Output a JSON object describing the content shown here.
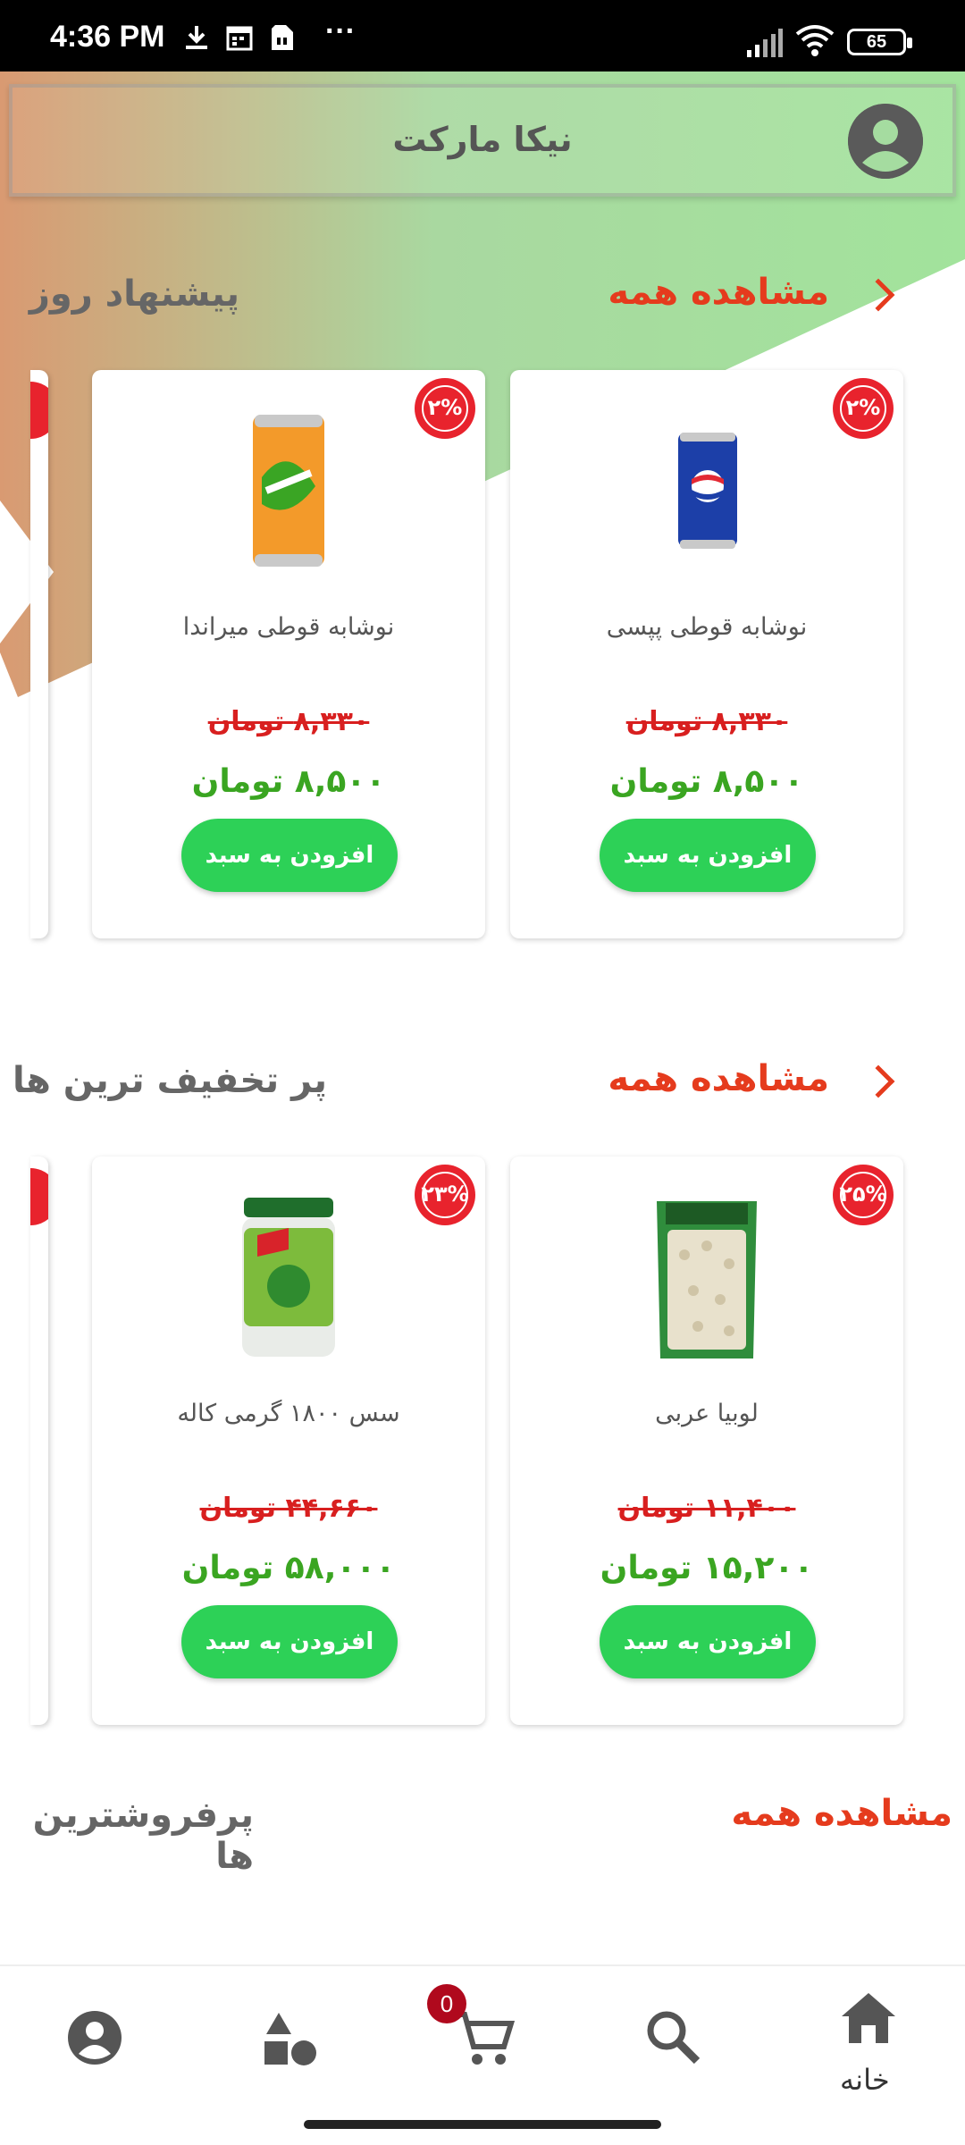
{
  "status_bar": {
    "time": "4:36 PM",
    "dots": "···",
    "battery": "65"
  },
  "header": {
    "title": "نیکا مارکت"
  },
  "sections": [
    {
      "title": "پیشنهاد روز",
      "see_all": "مشاهده همه",
      "products": [
        {
          "name": "نوشابه قوطی پپسی",
          "discount": "۲%",
          "old_price": "۸,۳۳۰ تومان",
          "new_price": "۸,۵۰۰ تومان",
          "button": "افزودن به سبد",
          "image": "pepsi-can"
        },
        {
          "name": "نوشابه قوطی میراندا",
          "discount": "۲%",
          "old_price": "۸,۳۳۰ تومان",
          "new_price": "۸,۵۰۰ تومان",
          "button": "افزودن به سبد",
          "image": "mirinda-can"
        }
      ]
    },
    {
      "title": "پر تخفیف ترین ها",
      "see_all": "مشاهده همه",
      "products": [
        {
          "name": "لوبیا عربی",
          "discount": "۲۵%",
          "old_price": "۱۱,۴۰۰ تومان",
          "new_price": "۱۵,۲۰۰ تومان",
          "button": "افزودن به سبد",
          "image": "beans-bag"
        },
        {
          "name": "سس ۱۸۰۰ گرمی کاله",
          "discount": "۲۳%",
          "old_price": "۴۴,۶۶۰ تومان",
          "new_price": "۵۸,۰۰۰ تومان",
          "button": "افزودن به سبد",
          "image": "sauce-jar"
        }
      ]
    },
    {
      "title": "پرفروشترین ها",
      "see_all": "مشاهده همه"
    }
  ],
  "bottom_nav": {
    "items": [
      {
        "label": "خانه",
        "icon": "home-icon",
        "active": true
      },
      {
        "icon": "search-icon"
      },
      {
        "icon": "cart-icon",
        "badge": "0"
      },
      {
        "icon": "categories-icon"
      },
      {
        "icon": "profile-icon"
      }
    ]
  },
  "colors": {
    "accent_red": "#e53b1d",
    "price_green": "#3aa521",
    "button_green": "#2dd157",
    "badge_red": "#e8232d"
  }
}
